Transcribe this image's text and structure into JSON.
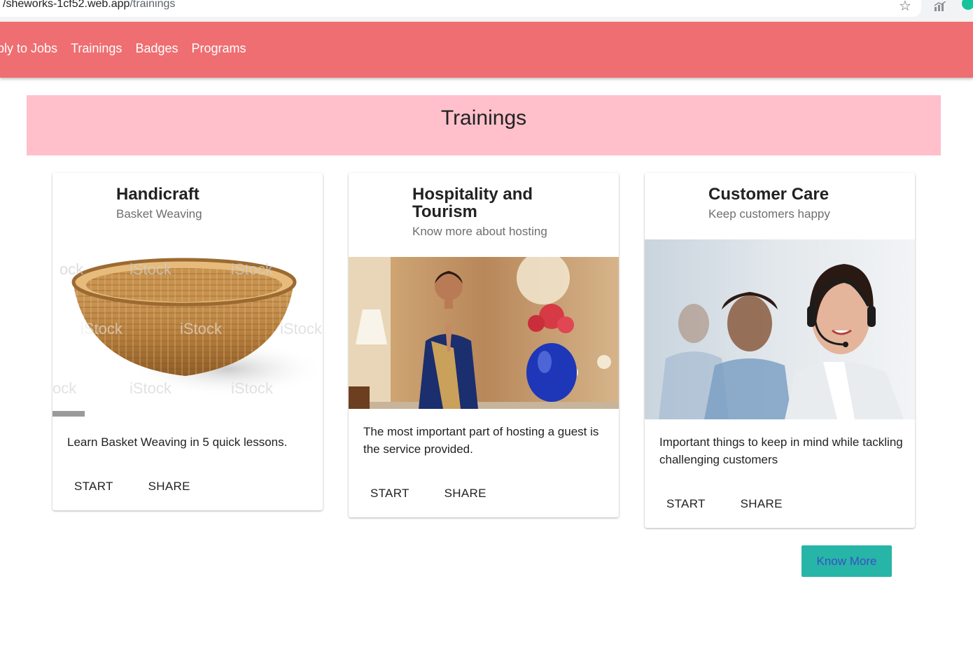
{
  "browser": {
    "url_host": "/sheworks-1cf52.web.app",
    "url_path": "/trainings",
    "star_icon": "star-icon"
  },
  "nav": {
    "links": [
      "pply to Jobs",
      "Trainings",
      "Badges",
      "Programs"
    ]
  },
  "banner": {
    "title": "Trainings"
  },
  "cards": [
    {
      "title": "Handicraft",
      "subtitle": "Basket Weaving",
      "image": "woven-basket-image",
      "description": "Learn Basket Weaving in 5 quick lessons.",
      "start_label": "START",
      "share_label": "SHARE"
    },
    {
      "title": "Hospitality and Tourism",
      "subtitle": "Know more about hosting",
      "image": "hotel-host-greeting-image",
      "description": "The most important part of hosting a guest is the service provided.",
      "start_label": "START",
      "share_label": "SHARE"
    },
    {
      "title": "Customer Care",
      "subtitle": "Keep customers happy",
      "image": "call-center-agent-image",
      "description": "Important things to keep in mind while tackling challenging customers",
      "start_label": "START",
      "share_label": "SHARE"
    }
  ],
  "know_more_label": "Know More",
  "colors": {
    "navbar": "#ef6e71",
    "banner": "#ffc0cb",
    "know_more_bg": "#26b5a6",
    "know_more_text": "#3b4fc8"
  }
}
